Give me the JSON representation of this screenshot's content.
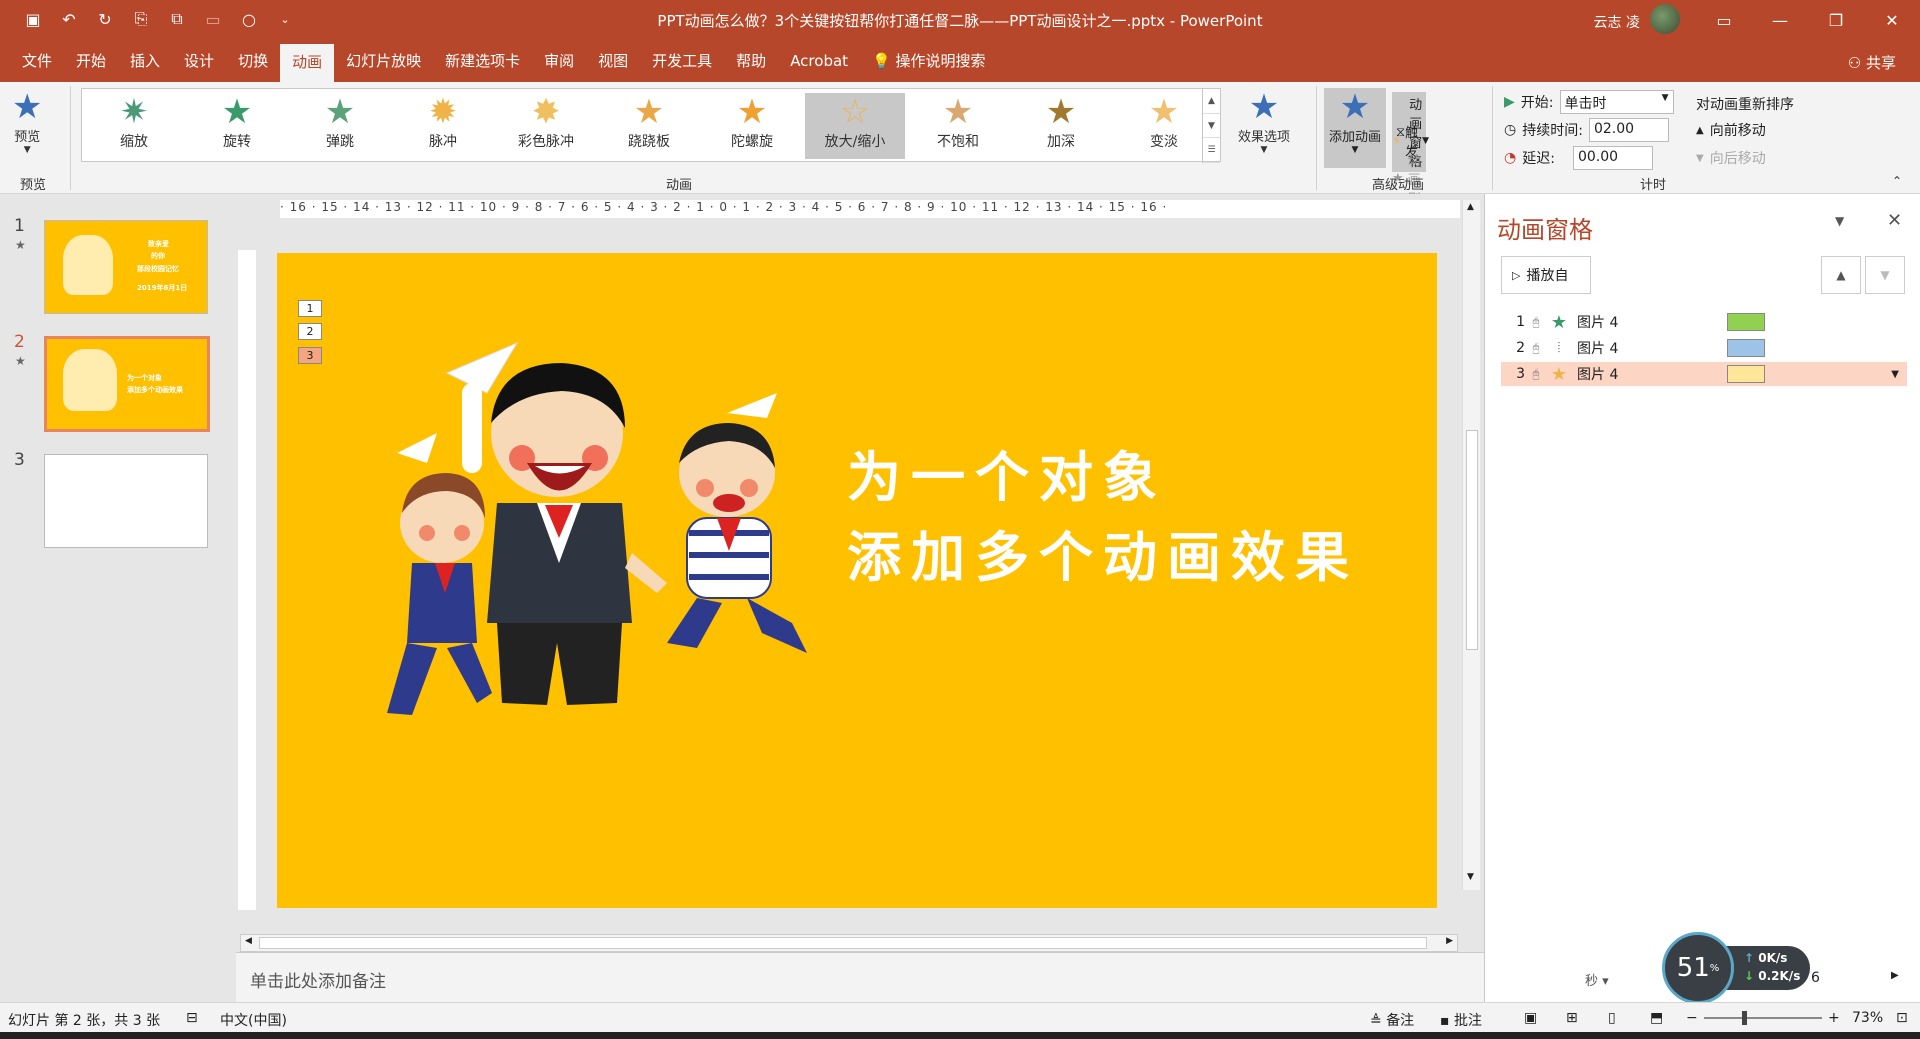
{
  "window": {
    "title": "PPT动画怎么做？3个关键按钮帮你打通任督二脉——PPT动画设计之一.pptx  -  PowerPoint",
    "user": "云志 凌",
    "qat_icons": [
      "save-icon",
      "undo-icon",
      "redo-icon",
      "start-from-beginning-icon",
      "new-slide-icon",
      "present-icon",
      "shape-circle-icon",
      "customize-qat-icon"
    ]
  },
  "tabs": [
    "文件",
    "开始",
    "插入",
    "设计",
    "切换",
    "动画",
    "幻灯片放映",
    "新建选项卡",
    "审阅",
    "视图",
    "开发工具",
    "帮助",
    "Acrobat",
    "操作说明搜索"
  ],
  "active_tab": "动画",
  "share_label": "共享",
  "ribbon": {
    "preview": {
      "label": "预览",
      "group": "预览"
    },
    "animations_group": "动画",
    "gallery": [
      {
        "label": "缩放",
        "color": "#4a9a7a"
      },
      {
        "label": "旋转",
        "color": "#3a9a6a"
      },
      {
        "label": "弹跳",
        "color": "#5aa27a"
      },
      {
        "label": "脉冲",
        "color": "#f0b34a"
      },
      {
        "label": "彩色脉冲",
        "color": "#f0c060"
      },
      {
        "label": "跷跷板",
        "color": "#e8a84a"
      },
      {
        "label": "陀螺旋",
        "color": "#f0a030"
      },
      {
        "label": "放大/缩小",
        "color": "#e8b45a"
      },
      {
        "label": "不饱和",
        "color": "#d8a870"
      },
      {
        "label": "加深",
        "color": "#a07830"
      },
      {
        "label": "变淡",
        "color": "#f0c070"
      }
    ],
    "gallery_selected": "放大/缩小",
    "effect_options": "效果选项",
    "advanced": {
      "group": "高级动画",
      "add_animation": "添加动画",
      "animation_pane": "动画窗格",
      "trigger": "触发",
      "painter": "动画刷"
    },
    "timing": {
      "group": "计时",
      "start_label": "开始:",
      "start_value": "单击时",
      "duration_label": "持续时间:",
      "duration_value": "02.00",
      "delay_label": "延迟:",
      "delay_value": "00.00"
    },
    "reorder": {
      "title": "对动画重新排序",
      "earlier": "向前移动",
      "later": "向后移动"
    }
  },
  "thumbnails": [
    {
      "num": "1",
      "star": "★",
      "lines": [
        "致亲爱",
        "的你",
        "那段校园记忆",
        "2019年6月1日"
      ]
    },
    {
      "num": "2",
      "star": "★",
      "lines": [
        "为一个对象",
        "添加多个动画效果"
      ]
    },
    {
      "num": "3",
      "star": "",
      "lines": []
    }
  ],
  "ruler_text": "· 16 · 15 · 14 · 13 · 12 · 11 · 10 · 9 · 8 · 7 · 6 · 5 · 4 · 3 · 2 · 1 · 0 · 1 · 2 · 3 · 4 · 5 · 6 · 7 · 8 · 9 · 10 · 11 · 12 · 13 · 14 · 15 · 16 ·",
  "slide": {
    "background": "#ffc000",
    "order_tags": [
      "1",
      "2",
      "3"
    ],
    "line1": "为一个对象",
    "line2": "添加多个动画效果"
  },
  "notes_placeholder": "单击此处添加备注",
  "pane": {
    "title": "动画窗格",
    "play_label": "播放自",
    "items": [
      {
        "num": "1",
        "name": "图片 4",
        "star_color": "#3a9a6a",
        "bar_color": "#92d050",
        "trigger_icon": "mouse-click-icon"
      },
      {
        "num": "2",
        "name": "图片 4",
        "star_color": "#777777",
        "bar_color": "#9dc3e6",
        "trigger_icon": "mouse-click-icon"
      },
      {
        "num": "3",
        "name": "图片 4",
        "star_color": "#f0b34a",
        "bar_color": "#ffe699",
        "trigger_icon": "mouse-click-icon"
      }
    ],
    "seconds_label": "秒",
    "scale_value": "6"
  },
  "net_monitor": {
    "percent": "51",
    "up": "0K/s",
    "down": "0.2K/s"
  },
  "status": {
    "slide_info": "幻灯片 第 2 张，共 3 张",
    "language": "中文(中国)",
    "notes": "备注",
    "comments": "批注",
    "zoom": "73%"
  }
}
